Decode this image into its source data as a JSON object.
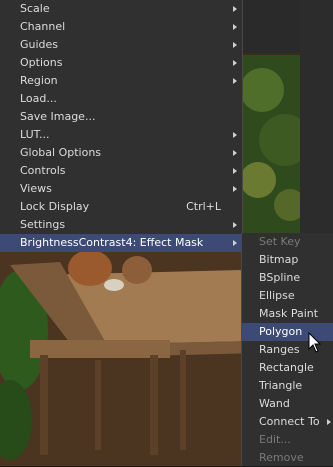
{
  "menu": {
    "items": [
      {
        "label": "Scale",
        "submenu": true
      },
      {
        "label": "Channel",
        "submenu": true
      },
      {
        "label": "Guides",
        "submenu": true
      },
      {
        "label": "Options",
        "submenu": true
      },
      {
        "label": "Region",
        "submenu": true
      },
      {
        "label": "Load...",
        "submenu": false
      },
      {
        "label": "Save Image...",
        "submenu": false
      },
      {
        "label": "LUT...",
        "submenu": true
      },
      {
        "label": "Global Options",
        "submenu": true
      },
      {
        "label": "Controls",
        "submenu": true
      },
      {
        "label": "Views",
        "submenu": true
      },
      {
        "label": "Lock Display",
        "submenu": false,
        "shortcut": "Ctrl+L"
      },
      {
        "label": "Settings",
        "submenu": true
      },
      {
        "label": "BrightnessContrast4: Effect Mask",
        "submenu": true,
        "active": true
      }
    ]
  },
  "submenu": {
    "items": [
      {
        "label": "Set Key",
        "disabled": true
      },
      {
        "label": "Bitmap"
      },
      {
        "label": "BSpline"
      },
      {
        "label": "Ellipse"
      },
      {
        "label": "Mask Paint"
      },
      {
        "label": "Polygon",
        "active": true
      },
      {
        "label": "Ranges"
      },
      {
        "label": "Rectangle"
      },
      {
        "label": "Triangle"
      },
      {
        "label": "Wand"
      },
      {
        "label": "Connect To",
        "submenu": true
      },
      {
        "label": "Edit...",
        "disabled": true
      },
      {
        "label": "Remove",
        "disabled": true
      }
    ]
  },
  "colors": {
    "menu_bg": "#303030",
    "highlight": "#3d4a75",
    "text": "#dcdcdc",
    "disabled_text": "#7a7a7a"
  }
}
